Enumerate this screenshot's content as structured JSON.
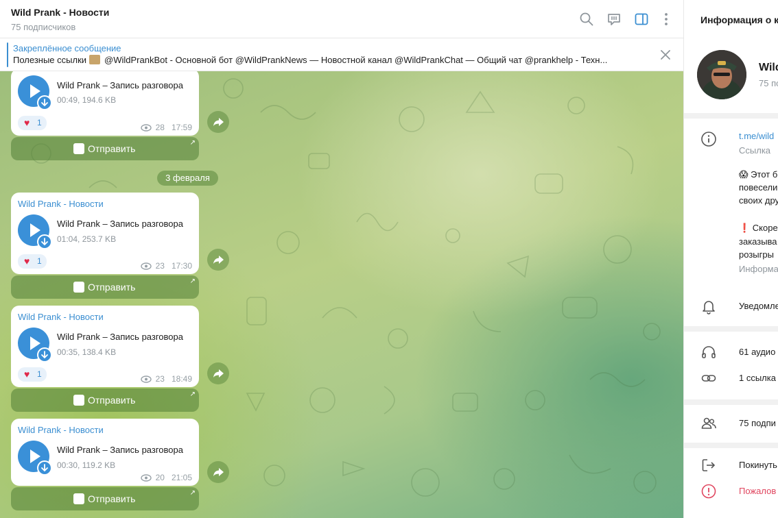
{
  "chat": {
    "title": "Wild Prank - Новости",
    "subscribers": "75 подписчиков",
    "header_icons": [
      "search-icon",
      "comments-icon",
      "sidebar-toggle-icon",
      "more-vertical-icon"
    ]
  },
  "pinned": {
    "title": "Закреплённое сообщение",
    "text_before": "Полезные ссылки",
    "text_after": "@WildPrankBot - Основной бот  @WildPrankNews — Новостной канал  @WildPrankChat — Общий чат  @prankhelp - Техн..."
  },
  "date_separator": "3 февраля",
  "messages": [
    {
      "sender": "",
      "title": "Wild Prank – Запись разговора",
      "meta": "00:49, 194.6 KB",
      "reaction_emoji": "♥",
      "reaction_count": "1",
      "views": "28",
      "time": "17:59",
      "button": "Отправить"
    },
    {
      "sender": "Wild Prank - Новости",
      "title": "Wild Prank – Запись разговора",
      "meta": "01:04, 253.7 KB",
      "reaction_emoji": "♥",
      "reaction_count": "1",
      "views": "23",
      "time": "17:30",
      "button": "Отправить"
    },
    {
      "sender": "Wild Prank - Новости",
      "title": "Wild Prank – Запись разговора",
      "meta": "00:35, 138.4 KB",
      "reaction_emoji": "♥",
      "reaction_count": "1",
      "views": "23",
      "time": "18:49",
      "button": "Отправить"
    },
    {
      "sender": "Wild Prank - Новости",
      "title": "Wild Prank – Запись разговора",
      "meta": "00:30, 119.2 KB",
      "reaction_emoji": "",
      "reaction_count": "",
      "views": "20",
      "time": "21:05",
      "button": "Отправить"
    }
  ],
  "panel": {
    "title": "Информация о к",
    "name": "Wild",
    "subscribers": "75 по",
    "link": "t.me/wild",
    "link_label": "Ссылка",
    "desc1": [
      "😱 Этот б",
      "повесели",
      "своих дру"
    ],
    "desc2": [
      "❗ Скоре",
      "заказыва",
      "розыгры"
    ],
    "desc_label": "Информа",
    "notifications": "Уведомле",
    "audio": "61 аудио",
    "links": "1 ссылка",
    "members": "75 подпи",
    "leave": "Покинуть",
    "report": "Пожалов"
  },
  "colors": {
    "accent": "#3a8ed1",
    "heart": "#e0294a",
    "danger": "#e0465f"
  }
}
